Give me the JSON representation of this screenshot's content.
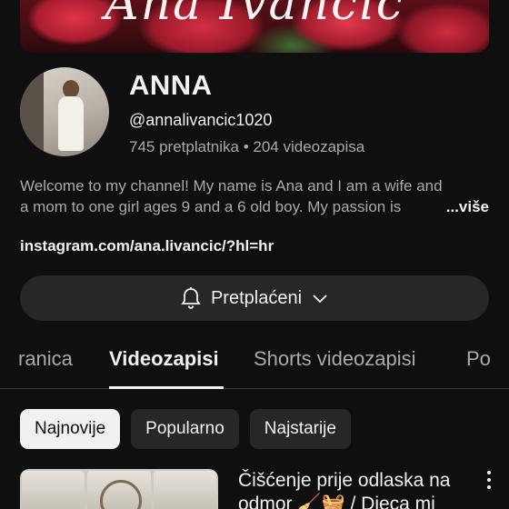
{
  "banner": {
    "script_text": "Ana Ivancic"
  },
  "channel": {
    "name": "ANNA",
    "handle": "@annalivancic1020",
    "stats": "745 pretplatnika • 204 videozapisa",
    "description_line1": "Welcome to my channel! My name is Ana and I am a wife and",
    "description_line2": "a mom to one girl ages 9 and a 6 old boy. My passion is",
    "more_label": "...više",
    "link": "instagram.com/ana.livancic/?hl=hr"
  },
  "subscribe": {
    "label": "Pretplaćeni"
  },
  "tabs": [
    {
      "label": "ranica"
    },
    {
      "label": "Videozapisi",
      "active": true
    },
    {
      "label": "Shorts videozapisi"
    },
    {
      "label": "Po"
    }
  ],
  "chips": [
    {
      "label": "Najnovije",
      "selected": true
    },
    {
      "label": "Popularno"
    },
    {
      "label": "Najstarije"
    }
  ],
  "video": {
    "title": "Čišćenje prije odlaska na odmor 🧹🧺 / Dieca mi"
  },
  "icons": {
    "bell": "bell-icon",
    "chevron": "chevron-down-icon",
    "more_vert": "more-vert-icon"
  },
  "colors": {
    "background": "#0f0f0f",
    "surface": "#272727",
    "text_primary": "#f1f1f1",
    "text_secondary": "#aaaaaa"
  }
}
